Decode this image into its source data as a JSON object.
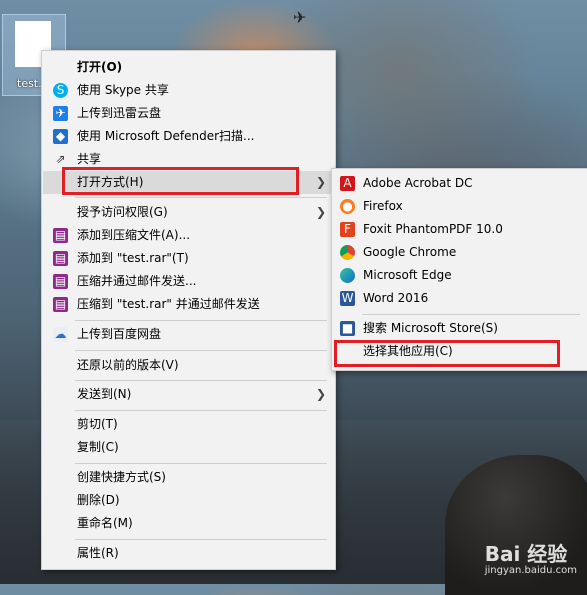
{
  "desktop": {
    "file_name": "test.r",
    "watermark": "Bai 经验",
    "watermark_url": "jingyan.baidu.com"
  },
  "main_menu": {
    "open": "打开(O)",
    "skype": "使用 Skype 共享",
    "xunlei": "上传到迅雷云盘",
    "defender": "使用 Microsoft Defender扫描...",
    "share": "共享",
    "open_with": "打开方式(H)",
    "grant_access": "授予访问权限(G)",
    "add_archive": "添加到压缩文件(A)...",
    "add_test_rar": "添加到 \"test.rar\"(T)",
    "compress_email": "压缩并通过邮件发送...",
    "compress_test_email": "压缩到 \"test.rar\" 并通过邮件发送",
    "baidu_pan": "上传到百度网盘",
    "restore": "还原以前的版本(V)",
    "send_to": "发送到(N)",
    "cut": "剪切(T)",
    "copy": "复制(C)",
    "shortcut": "创建快捷方式(S)",
    "delete": "删除(D)",
    "rename": "重命名(M)",
    "properties": "属性(R)"
  },
  "sub_menu": {
    "acrobat": "Adobe Acrobat DC",
    "firefox": "Firefox",
    "foxit": "Foxit PhantomPDF 10.0",
    "chrome": "Google Chrome",
    "edge": "Microsoft Edge",
    "word": "Word 2016",
    "store": "搜索 Microsoft Store(S)",
    "choose_other": "选择其他应用(C)"
  },
  "colors": {
    "highlight_box": "#e31d24",
    "menu_bg": "#f2f2f2"
  }
}
